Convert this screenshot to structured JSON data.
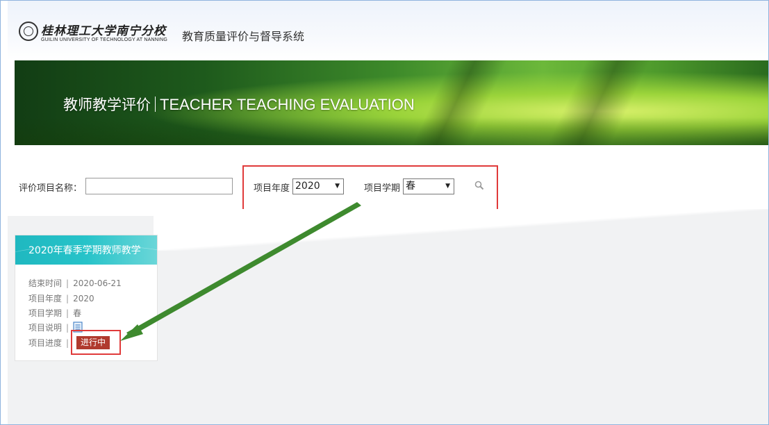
{
  "header": {
    "logo_cn": "桂林理工大学南宁分校",
    "logo_en": "GUILIN UNIVERSITY OF TECHNOLOGY AT NANNING",
    "system_title": "教育质量评价与督导系统"
  },
  "banner": {
    "title_cn": "教师教学评价",
    "title_en": "TEACHER TEACHING EVALUATION"
  },
  "filters": {
    "name_label": "评价项目名称：",
    "name_value": "",
    "year_label": "项目年度",
    "year_value": "2020",
    "term_label": "项目学期",
    "term_value": "春",
    "search_icon": "search-icon"
  },
  "card": {
    "title": "2020年春季学期教师教学",
    "rows": [
      {
        "label": "结束时间",
        "value": "2020-06-21"
      },
      {
        "label": "项目年度",
        "value": "2020"
      },
      {
        "label": "项目学期",
        "value": "春"
      },
      {
        "label": "项目说明",
        "icon": "document-icon"
      },
      {
        "label": "项目进度",
        "status": "进行中"
      }
    ]
  },
  "colors": {
    "highlight": "#e03a3a",
    "card_header": "#27c3c9",
    "status_badge": "#b03a2e",
    "arrow": "#3e8a2e"
  }
}
